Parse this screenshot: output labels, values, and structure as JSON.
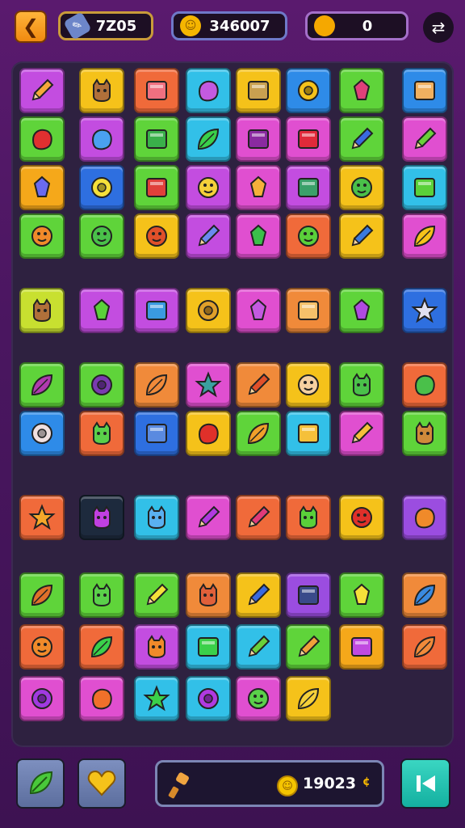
{
  "header": {
    "back_icon": "chevron-left-icon",
    "counter_1": {
      "icon": "pencil-icon",
      "value": "7Z05"
    },
    "counter_2": {
      "icon": "coin-icon",
      "value": "346007"
    },
    "counter_3": {
      "icon": "coin-icon",
      "value": "0"
    },
    "settings_icon": "shuffle-icon"
  },
  "board": {
    "columns": 8,
    "tiles": [
      {
        "r": 0,
        "c": 0,
        "color": "#c34de0",
        "icon": "carrot"
      },
      {
        "r": 0,
        "c": 1,
        "color": "#f5c21a",
        "icon": "monkey-face"
      },
      {
        "r": 0,
        "c": 2,
        "color": "#f06a3a",
        "icon": "gift-box"
      },
      {
        "r": 0,
        "c": 3,
        "color": "#32c0e8",
        "icon": "cloud"
      },
      {
        "r": 0,
        "c": 4,
        "color": "#f5c21a",
        "icon": "treasure-box"
      },
      {
        "r": 0,
        "c": 5,
        "color": "#2e8be8",
        "icon": "donut"
      },
      {
        "r": 0,
        "c": 6,
        "color": "#5fd43a",
        "icon": "radish"
      },
      {
        "r": 0,
        "c": 7,
        "color": "#2e8be8",
        "icon": "notepad"
      },
      {
        "r": 1,
        "c": 0,
        "color": "#5fd43a",
        "icon": "drumstick"
      },
      {
        "r": 1,
        "c": 1,
        "color": "#c34de0",
        "icon": "blue-blob"
      },
      {
        "r": 1,
        "c": 2,
        "color": "#5fd43a",
        "icon": "green-card"
      },
      {
        "r": 1,
        "c": 3,
        "color": "#32c0e8",
        "icon": "green-leaf"
      },
      {
        "r": 1,
        "c": 4,
        "color": "#e04fd0",
        "icon": "purple-card"
      },
      {
        "r": 1,
        "c": 5,
        "color": "#e04fd0",
        "icon": "red-box"
      },
      {
        "r": 1,
        "c": 6,
        "color": "#5fd43a",
        "icon": "blue-pencil"
      },
      {
        "r": 1,
        "c": 7,
        "color": "#e04fd0",
        "icon": "green-pencil"
      },
      {
        "r": 2,
        "c": 0,
        "color": "#f5a81a",
        "icon": "key"
      },
      {
        "r": 2,
        "c": 1,
        "color": "#2e6fe0",
        "icon": "yellow-ring"
      },
      {
        "r": 2,
        "c": 2,
        "color": "#5fd43a",
        "icon": "red-book"
      },
      {
        "r": 2,
        "c": 3,
        "color": "#c34de0",
        "icon": "yellow-fruit"
      },
      {
        "r": 2,
        "c": 4,
        "color": "#e04fd0",
        "icon": "pizza"
      },
      {
        "r": 2,
        "c": 5,
        "color": "#c34de0",
        "icon": "green-box"
      },
      {
        "r": 2,
        "c": 6,
        "color": "#f5c21a",
        "icon": "green-ball"
      },
      {
        "r": 2,
        "c": 7,
        "color": "#32c0e8",
        "icon": "green-battery"
      },
      {
        "r": 3,
        "c": 0,
        "color": "#5fd43a",
        "icon": "orange-face"
      },
      {
        "r": 3,
        "c": 1,
        "color": "#5fd43a",
        "icon": "green-ball"
      },
      {
        "r": 3,
        "c": 2,
        "color": "#f5c21a",
        "icon": "apple"
      },
      {
        "r": 3,
        "c": 3,
        "color": "#c34de0",
        "icon": "rocket"
      },
      {
        "r": 3,
        "c": 4,
        "color": "#e04fd0",
        "icon": "green-gem"
      },
      {
        "r": 3,
        "c": 5,
        "color": "#f06a3a",
        "icon": "green-smile"
      },
      {
        "r": 3,
        "c": 6,
        "color": "#f5c21a",
        "icon": "blue-tube"
      },
      {
        "r": 3,
        "c": 7,
        "color": "#e04fd0",
        "icon": "sprout"
      },
      {
        "r": 4,
        "c": 0,
        "color": "#c8e030",
        "icon": "monkey-face"
      },
      {
        "r": 4,
        "c": 1,
        "color": "#c34de0",
        "icon": "bell"
      },
      {
        "r": 4,
        "c": 2,
        "color": "#c34de0",
        "icon": "jar"
      },
      {
        "r": 4,
        "c": 3,
        "color": "#f5c21a",
        "icon": "gear-key"
      },
      {
        "r": 4,
        "c": 4,
        "color": "#e04fd0",
        "icon": "arrow"
      },
      {
        "r": 4,
        "c": 5,
        "color": "#f08a3a",
        "icon": "lantern"
      },
      {
        "r": 4,
        "c": 6,
        "color": "#5fd43a",
        "icon": "purple-wing"
      },
      {
        "r": 4,
        "c": 7,
        "color": "#2e6fe0",
        "icon": "comet"
      },
      {
        "r": 5,
        "c": 0,
        "color": "#5fd43a",
        "icon": "purple-pod"
      },
      {
        "r": 5,
        "c": 1,
        "color": "#5fd43a",
        "icon": "wreath"
      },
      {
        "r": 5,
        "c": 2,
        "color": "#f08a3a",
        "icon": "orange-feather"
      },
      {
        "r": 5,
        "c": 3,
        "color": "#e04fd0",
        "icon": "splash"
      },
      {
        "r": 5,
        "c": 4,
        "color": "#f08a3a",
        "icon": "brush"
      },
      {
        "r": 5,
        "c": 5,
        "color": "#f5c21a",
        "icon": "boy-face"
      },
      {
        "r": 5,
        "c": 6,
        "color": "#5fd43a",
        "icon": "goblin-face"
      },
      {
        "r": 5,
        "c": 7,
        "color": "#f06a3a",
        "icon": "green-pod"
      },
      {
        "r": 6,
        "c": 0,
        "color": "#2e8be8",
        "icon": "striped-ball"
      },
      {
        "r": 6,
        "c": 1,
        "color": "#f06a3a",
        "icon": "green-cat"
      },
      {
        "r": 6,
        "c": 2,
        "color": "#2e6fe0",
        "icon": "blue-panel"
      },
      {
        "r": 6,
        "c": 3,
        "color": "#f5c21a",
        "icon": "red-bean"
      },
      {
        "r": 6,
        "c": 4,
        "color": "#5fd43a",
        "icon": "orange-leaf"
      },
      {
        "r": 6,
        "c": 5,
        "color": "#32c0e8",
        "icon": "scrolls"
      },
      {
        "r": 6,
        "c": 6,
        "color": "#e04fd0",
        "icon": "yellow-pencil"
      },
      {
        "r": 6,
        "c": 7,
        "color": "#5fd43a",
        "icon": "cat-face"
      },
      {
        "r": 7,
        "c": 0,
        "color": "#f06a3a",
        "icon": "star"
      },
      {
        "r": 7,
        "c": 1,
        "color": "#1d2a3d",
        "icon": "purple-cat"
      },
      {
        "r": 7,
        "c": 2,
        "color": "#32c0e8",
        "icon": "blue-cat"
      },
      {
        "r": 7,
        "c": 3,
        "color": "#e04fd0",
        "icon": "purple-pencil"
      },
      {
        "r": 7,
        "c": 4,
        "color": "#f06a3a",
        "icon": "pink-pencil"
      },
      {
        "r": 7,
        "c": 5,
        "color": "#f06a3a",
        "icon": "green-monster"
      },
      {
        "r": 7,
        "c": 6,
        "color": "#f5c21a",
        "icon": "red-apple"
      },
      {
        "r": 7,
        "c": 7,
        "color": "#9b4de0",
        "icon": "orange-balloon"
      },
      {
        "r": 8,
        "c": 0,
        "color": "#5fd43a",
        "icon": "shell"
      },
      {
        "r": 8,
        "c": 1,
        "color": "#5fd43a",
        "icon": "green-cat"
      },
      {
        "r": 8,
        "c": 2,
        "color": "#5fd43a",
        "icon": "bottle"
      },
      {
        "r": 8,
        "c": 3,
        "color": "#f08a3a",
        "icon": "crab"
      },
      {
        "r": 8,
        "c": 4,
        "color": "#f5c21a",
        "icon": "blue-pencil"
      },
      {
        "r": 8,
        "c": 5,
        "color": "#9b4de0",
        "icon": "briefcase"
      },
      {
        "r": 8,
        "c": 6,
        "color": "#5fd43a",
        "icon": "cheese"
      },
      {
        "r": 8,
        "c": 7,
        "color": "#f08a3a",
        "icon": "blue-leaf"
      },
      {
        "r": 9,
        "c": 0,
        "color": "#f06a3a",
        "icon": "orange-face"
      },
      {
        "r": 9,
        "c": 1,
        "color": "#f06a3a",
        "icon": "green-leaf"
      },
      {
        "r": 9,
        "c": 2,
        "color": "#c34de0",
        "icon": "orange-cat"
      },
      {
        "r": 9,
        "c": 3,
        "color": "#32c0e8",
        "icon": "green-bag"
      },
      {
        "r": 9,
        "c": 4,
        "color": "#32c0e8",
        "icon": "green-pencil"
      },
      {
        "r": 9,
        "c": 5,
        "color": "#5fd43a",
        "icon": "orange-pencil"
      },
      {
        "r": 9,
        "c": 6,
        "color": "#f5a81a",
        "icon": "purple-bar"
      },
      {
        "r": 9,
        "c": 7,
        "color": "#f06a3a",
        "icon": "orange-feather"
      },
      {
        "r": 10,
        "c": 0,
        "color": "#e04fd0",
        "icon": "purple-berry"
      },
      {
        "r": 10,
        "c": 1,
        "color": "#e04fd0",
        "icon": "orange-blob"
      },
      {
        "r": 10,
        "c": 2,
        "color": "#32c0e8",
        "icon": "green-star"
      },
      {
        "r": 10,
        "c": 3,
        "color": "#32c0e8",
        "icon": "purple-ring"
      },
      {
        "r": 10,
        "c": 4,
        "color": "#e04fd0",
        "icon": "striped-egg"
      },
      {
        "r": 10,
        "c": 5,
        "color": "#f5c21a",
        "icon": "yellow-leaf"
      }
    ]
  },
  "footer": {
    "leaf_icon": "leaf-icon",
    "heart_icon": "heart-icon",
    "tool_icon": "hammer-icon",
    "score_icon": "coin-icon",
    "score": "19023",
    "score_suffix": "¢",
    "next_icon": "skip-icon"
  }
}
